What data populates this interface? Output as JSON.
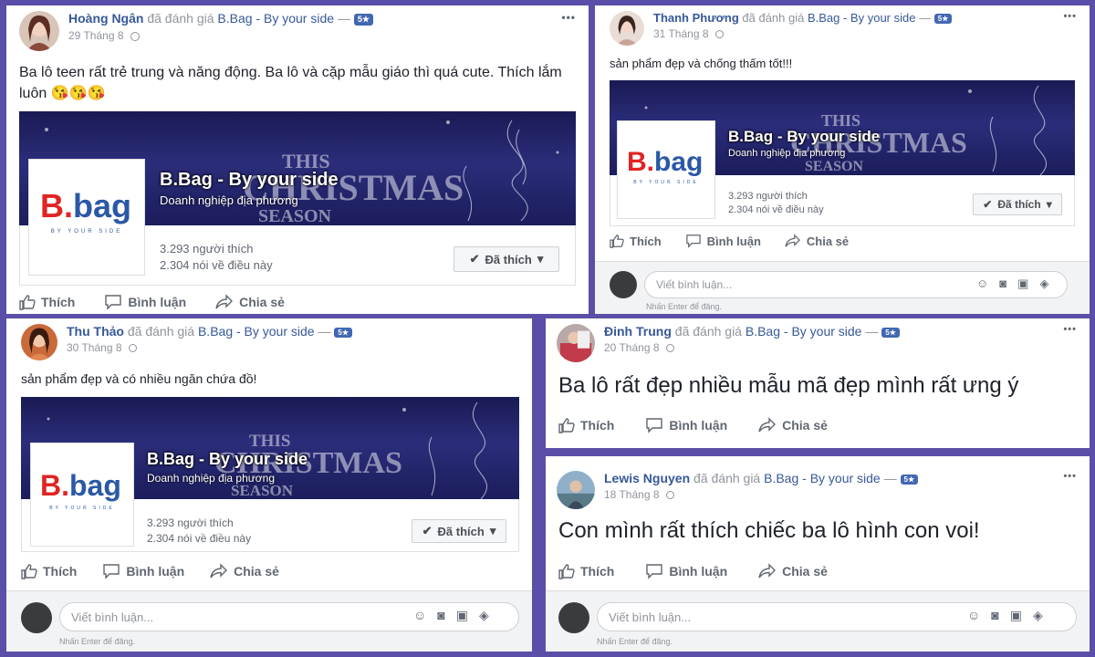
{
  "common": {
    "rated": "đã đánh giá",
    "page_name": "B.Bag - By your side",
    "dash": "—",
    "badge": "5★",
    "page_title": "B.Bag - By your side",
    "page_category": "Doanh nghiệp địa phương",
    "likes": "3.293 người thích",
    "talking": "2.304 nói về điều này",
    "liked_btn": "Đã thích",
    "like": "Thích",
    "comment": "Bình luận",
    "share": "Chia sẻ",
    "comment_placeholder": "Viết bình luận...",
    "enter_hint": "Nhấn Enter để đăng.",
    "logo_b": "B.",
    "logo_bag": "bag",
    "logo_tagline": "BY YOUR SIDE",
    "xmas_1": "THIS",
    "xmas_2": "CHRISTMAS",
    "xmas_3": "SEASON",
    "more": "•••"
  },
  "posts": [
    {
      "author": "Hoàng Ngân",
      "date": "29 Tháng 8",
      "text": "Ba lô teen rất trẻ trung và năng động. Ba lô và cặp mẫu giáo thì quá cute. Thích lắm luôn",
      "emoji": "😘😘😘"
    },
    {
      "author": "Thanh Phương",
      "date": "31 Tháng 8",
      "text": "sản phẩm đẹp và chống thấm tốt!!!"
    },
    {
      "author": "Thu Thảo",
      "date": "30 Tháng 8",
      "text": "sản phẩm đẹp và có nhiều ngăn chứa đồ!"
    },
    {
      "author": "Đinh Trung",
      "date": "20 Tháng 8",
      "text": "Ba lô rất đẹp nhiều mẫu mã đẹp mình rất ưng ý"
    },
    {
      "author": "Lewis Nguyen",
      "date": "18 Tháng 8",
      "text": "Con mình rất thích chiếc ba lô hình con voi!"
    }
  ],
  "colors": {
    "frame": "#5a4fa8",
    "link": "#365899",
    "badge": "#4267b2",
    "logo_red": "#e02424",
    "logo_blue": "#2b58a6"
  }
}
